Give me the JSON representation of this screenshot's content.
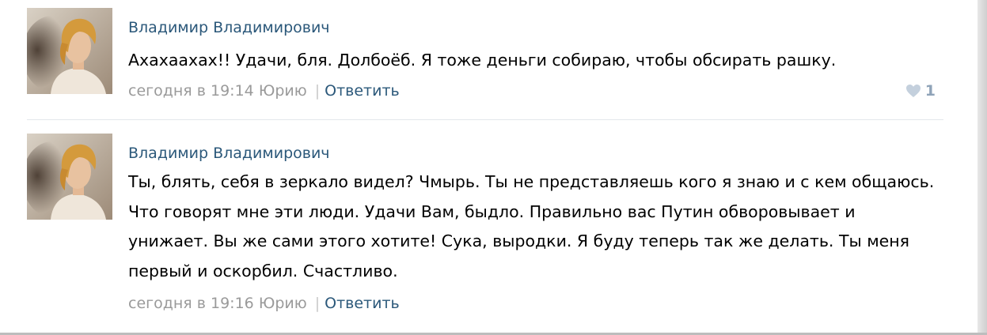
{
  "comments": [
    {
      "author": "Владимир Владимирович",
      "text": "Ахахаахах!! Удачи, бля. Долбоёб. Я тоже деньги собираю, чтобы обсирать рашку.",
      "time": "сегодня в 19:14",
      "reply_to": "Юрию",
      "reply_label": "Ответить",
      "likes": "1"
    },
    {
      "author": "Владимир Владимирович",
      "text": "Ты, блять, себя в зеркало видел? Чмырь. Ты не представляешь кого я знаю и с кем общаюсь. Что говорят мне эти люди. Удачи Вам, быдло. Правильно вас Путин обворовывает и унижает. Вы же сами этого хотите! Сука, выродки. Я буду теперь так же делать. Ты меня первый и оскорбил. Счастливо.",
      "time": "сегодня в 19:16",
      "reply_to": "Юрию",
      "reply_label": "Ответить"
    }
  ],
  "colors": {
    "link": "#2b587a",
    "meta": "#999999",
    "like": "#8fa3b8",
    "divider": "#e4e8ec"
  },
  "icons": {
    "like": "heart-icon",
    "avatar": "user-photo"
  }
}
